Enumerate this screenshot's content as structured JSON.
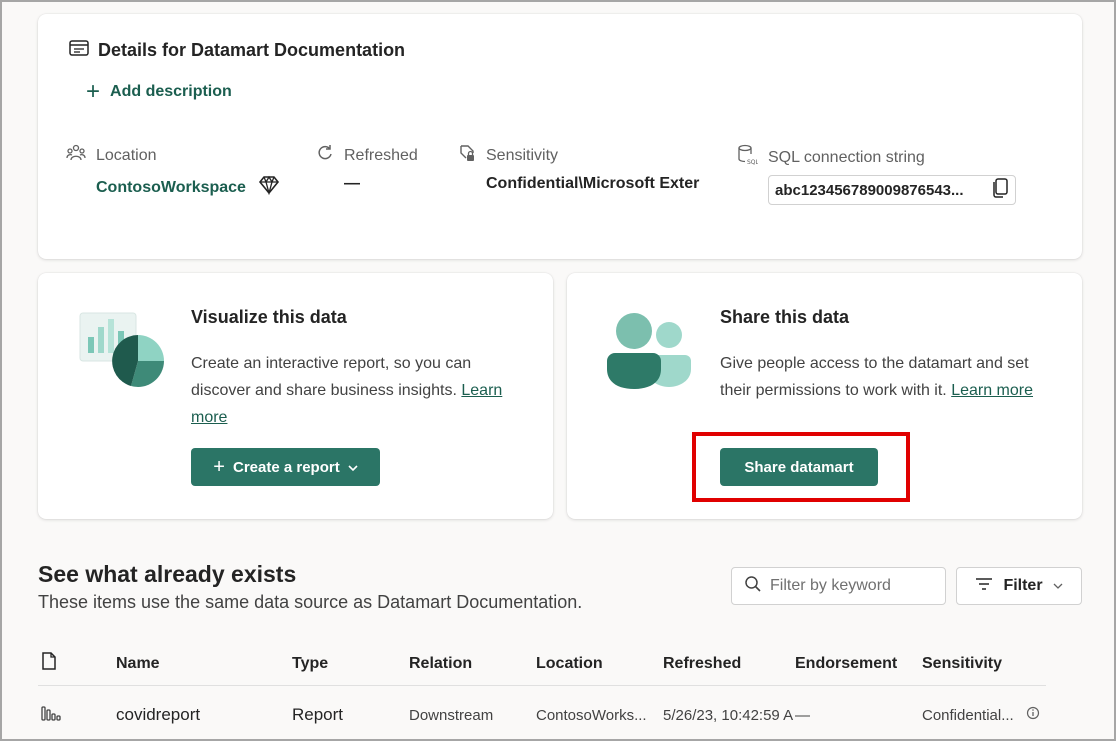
{
  "details": {
    "title": "Details for Datamart Documentation",
    "add_description": "Add description",
    "location_label": "Location",
    "location_value": "ContosoWorkspace",
    "refreshed_label": "Refreshed",
    "refreshed_value": "—",
    "sensitivity_label": "Sensitivity",
    "sensitivity_value": "Confidential\\Microsoft Exter",
    "sql_label": "SQL connection string",
    "sql_value": "abc123456789009876543..."
  },
  "visualize": {
    "title": "Visualize this data",
    "description": "Create an interactive report, so you can discover and share business insights.",
    "learn_more": "Learn more",
    "button": "Create a report"
  },
  "share": {
    "title": "Share this data",
    "description": "Give people access to the datamart and set their permissions to work with it.",
    "learn_more": "Learn more",
    "button": "Share datamart"
  },
  "exists": {
    "title": "See what already exists",
    "subtitle": "These items use the same data source as Datamart Documentation.",
    "search_placeholder": "Filter by keyword",
    "filter_label": "Filter"
  },
  "table": {
    "headers": {
      "name": "Name",
      "type": "Type",
      "relation": "Relation",
      "location": "Location",
      "refreshed": "Refreshed",
      "endorsement": "Endorsement",
      "sensitivity": "Sensitivity"
    },
    "rows": [
      {
        "name": "covidreport",
        "type": "Report",
        "relation": "Downstream",
        "location": "ContosoWorks...",
        "refreshed": "5/26/23, 10:42:59 A",
        "endorsement": "—",
        "sensitivity": "Confidential..."
      }
    ]
  },
  "colors": {
    "accent": "#2b7566",
    "link": "#1b5e4f",
    "highlight": "#e00000"
  }
}
